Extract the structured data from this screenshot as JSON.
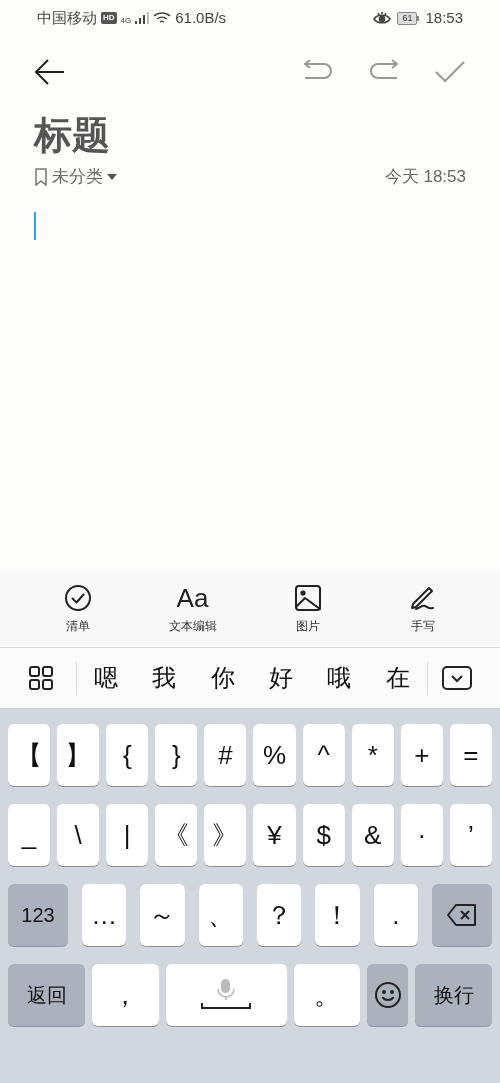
{
  "status_bar": {
    "carrier": "中国移动",
    "network_badge": "HD",
    "network_type": "4G",
    "speed": "61.0B/s",
    "battery": "61",
    "time": "18:53"
  },
  "note": {
    "title": "标题",
    "category": "未分类",
    "date": "今天 18:53",
    "body_focused": true
  },
  "tools": [
    {
      "kind": "checklist",
      "label": "清单"
    },
    {
      "kind": "text",
      "glyph": "Aa",
      "label": "文本编辑"
    },
    {
      "kind": "image",
      "label": "图片"
    },
    {
      "kind": "handwrite",
      "label": "手写"
    }
  ],
  "candidates": [
    "嗯",
    "我",
    "你",
    "好",
    "哦",
    "在"
  ],
  "keyboard": [
    [
      {
        "kind": "char",
        "label": "【"
      },
      {
        "kind": "char",
        "label": "】"
      },
      {
        "kind": "char",
        "label": "{"
      },
      {
        "kind": "char",
        "label": "}"
      },
      {
        "kind": "char",
        "label": "#"
      },
      {
        "kind": "char",
        "label": "%"
      },
      {
        "kind": "char",
        "label": "^"
      },
      {
        "kind": "char",
        "label": "*"
      },
      {
        "kind": "char",
        "label": "+"
      },
      {
        "kind": "char",
        "label": "="
      }
    ],
    [
      {
        "kind": "char",
        "label": "_"
      },
      {
        "kind": "char",
        "label": "\\"
      },
      {
        "kind": "char",
        "label": "|"
      },
      {
        "kind": "char",
        "label": "《"
      },
      {
        "kind": "char",
        "label": "》"
      },
      {
        "kind": "char",
        "label": "¥"
      },
      {
        "kind": "char",
        "label": "$"
      },
      {
        "kind": "char",
        "label": "&"
      },
      {
        "kind": "char",
        "label": "·"
      },
      {
        "kind": "char",
        "label": "’"
      }
    ],
    [
      {
        "kind": "function",
        "label": "123"
      },
      {
        "kind": "char",
        "label": "…"
      },
      {
        "kind": "char",
        "label": "～"
      },
      {
        "kind": "char",
        "label": "、"
      },
      {
        "kind": "char",
        "label": "？"
      },
      {
        "kind": "char",
        "label": "！"
      },
      {
        "kind": "char",
        "label": "."
      },
      {
        "kind": "backspace"
      }
    ],
    [
      {
        "kind": "function",
        "label": "返回"
      },
      {
        "kind": "char",
        "label": "，"
      },
      {
        "kind": "space"
      },
      {
        "kind": "char",
        "label": "。"
      },
      {
        "kind": "emoji"
      },
      {
        "kind": "function",
        "label": "换行"
      }
    ]
  ]
}
